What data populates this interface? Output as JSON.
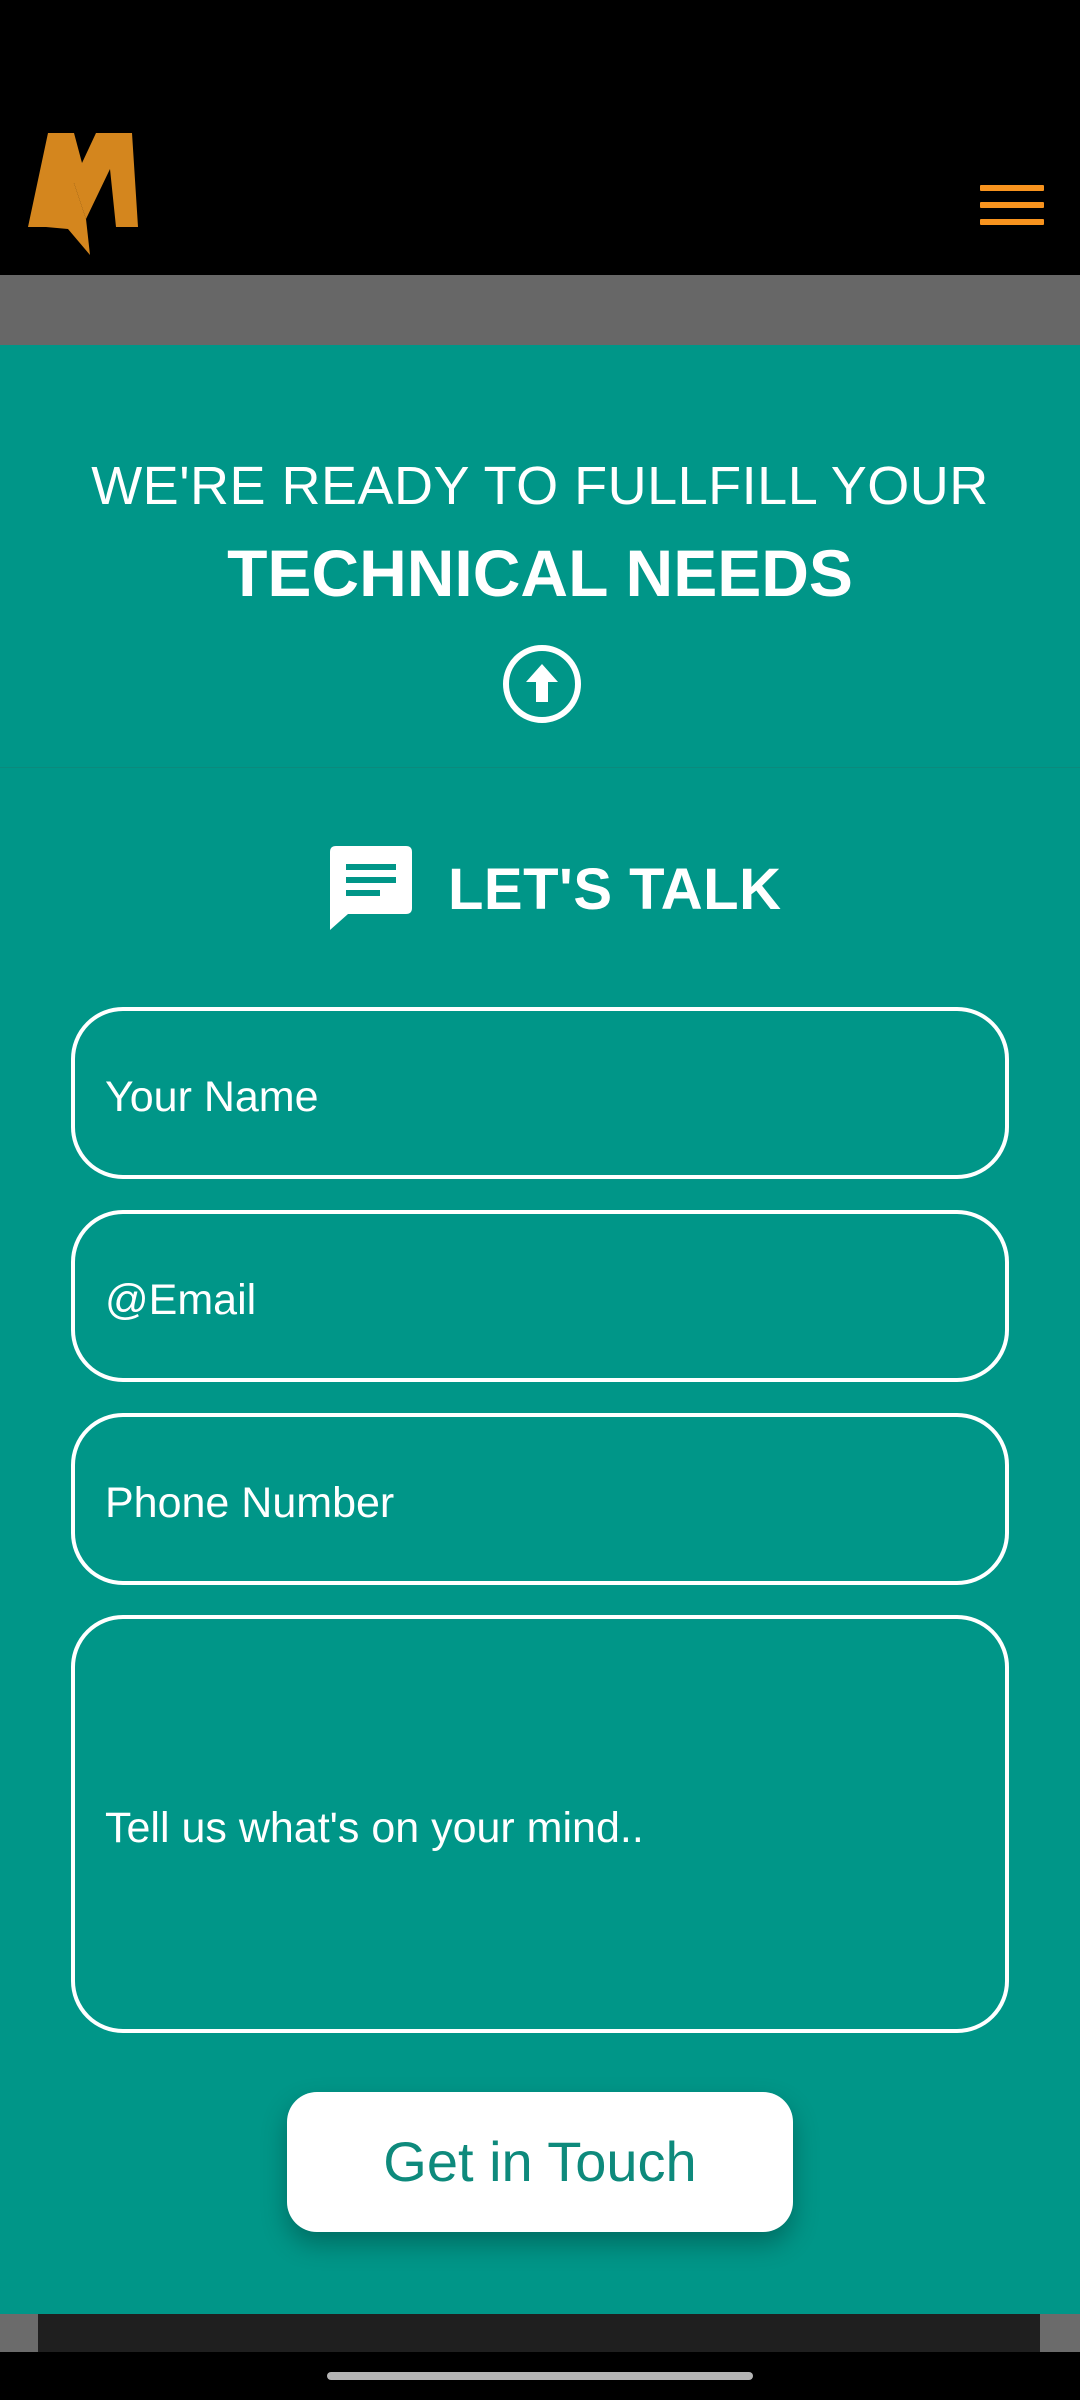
{
  "header": {
    "logo_icon": "brand-logo-icon",
    "menu_icon": "hamburger-menu-icon",
    "accent_color": "#f7931e",
    "logo_color": "#d4861e"
  },
  "hero": {
    "line1": "WE'RE READY TO FULLFILL YOUR",
    "line2": "TECHNICAL NEEDS",
    "scroll_icon": "arrow-up-circle-icon"
  },
  "contact": {
    "icon": "chat-message-icon",
    "title": "LET'S TALK",
    "name_placeholder": "Your Name",
    "email_placeholder": "@Email",
    "phone_placeholder": "Phone Number",
    "message_placeholder": "Tell us what's on your mind..",
    "submit_label": "Get in Touch"
  },
  "colors": {
    "background": "#009688",
    "header": "#000000",
    "button_text": "#0e8a7c"
  }
}
